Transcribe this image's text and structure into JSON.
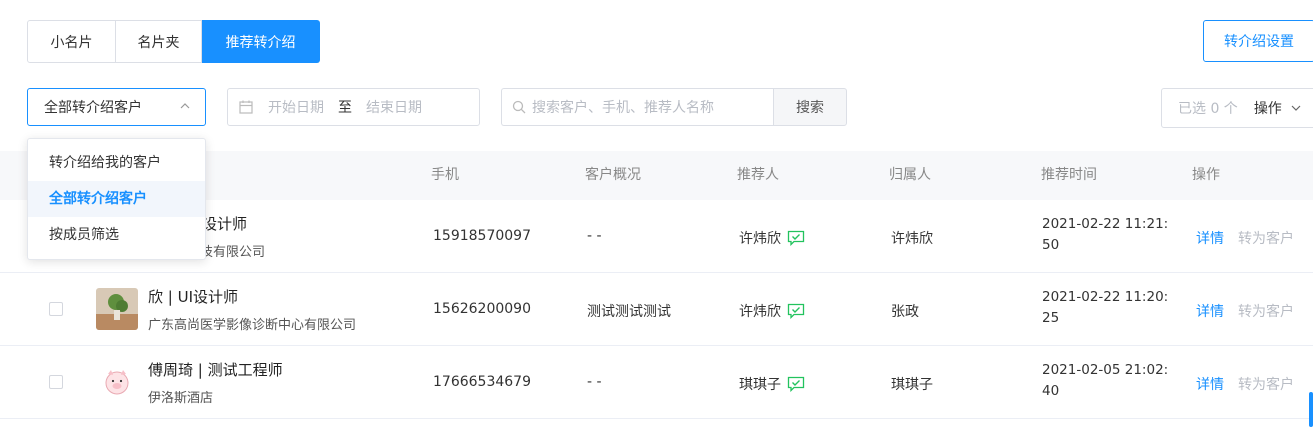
{
  "tabs": [
    {
      "label": "小名片"
    },
    {
      "label": "名片夹"
    },
    {
      "label": "推荐转介绍"
    }
  ],
  "settings_button": "转介绍设置",
  "filter": {
    "select_value": "全部转介绍客户",
    "date_start_placeholder": "开始日期",
    "date_separator": "至",
    "date_end_placeholder": "结束日期",
    "search_placeholder": "搜索客户、手机、推荐人名称",
    "search_button": "搜索",
    "selected_count": "已选 0 个",
    "batch_ops": "操作"
  },
  "dropdown": {
    "options": [
      "转介绍给我的客户",
      "全部转介绍客户",
      "按成员筛选"
    ],
    "selected": "全部转介绍客户"
  },
  "table": {
    "headers": {
      "phone": "手机",
      "overview": "客户概况",
      "referrer": "推荐人",
      "owner": "归属人",
      "time": "推荐时间",
      "actions": "操作"
    },
    "rows": [
      {
        "name": "Vicky | 设计师",
        "company": "计算机科技有限公司",
        "phone": "15918570097",
        "overview": "- -",
        "referrer": "许炜欣",
        "owner": "许炜欣",
        "time": "2021-02-22 11:21:50",
        "detail": "详情",
        "convert": "转为客户"
      },
      {
        "name": "欣 | UI设计师",
        "company": "广东高尚医学影像诊断中心有限公司",
        "phone": "15626200090",
        "overview": "测试测试测试",
        "referrer": "许炜欣",
        "owner": "张政",
        "time": "2021-02-22 11:20:25",
        "detail": "详情",
        "convert": "转为客户"
      },
      {
        "name": "傅周琦 | 测试工程师",
        "company": "伊洛斯酒店",
        "phone": "17666534679",
        "overview": "- -",
        "referrer": "琪琪子",
        "owner": "琪琪子",
        "time": "2021-02-05 21:02:40",
        "detail": "详情",
        "convert": "转为客户"
      }
    ]
  },
  "colors": {
    "primary": "#1890ff",
    "verified": "#22c35e"
  }
}
